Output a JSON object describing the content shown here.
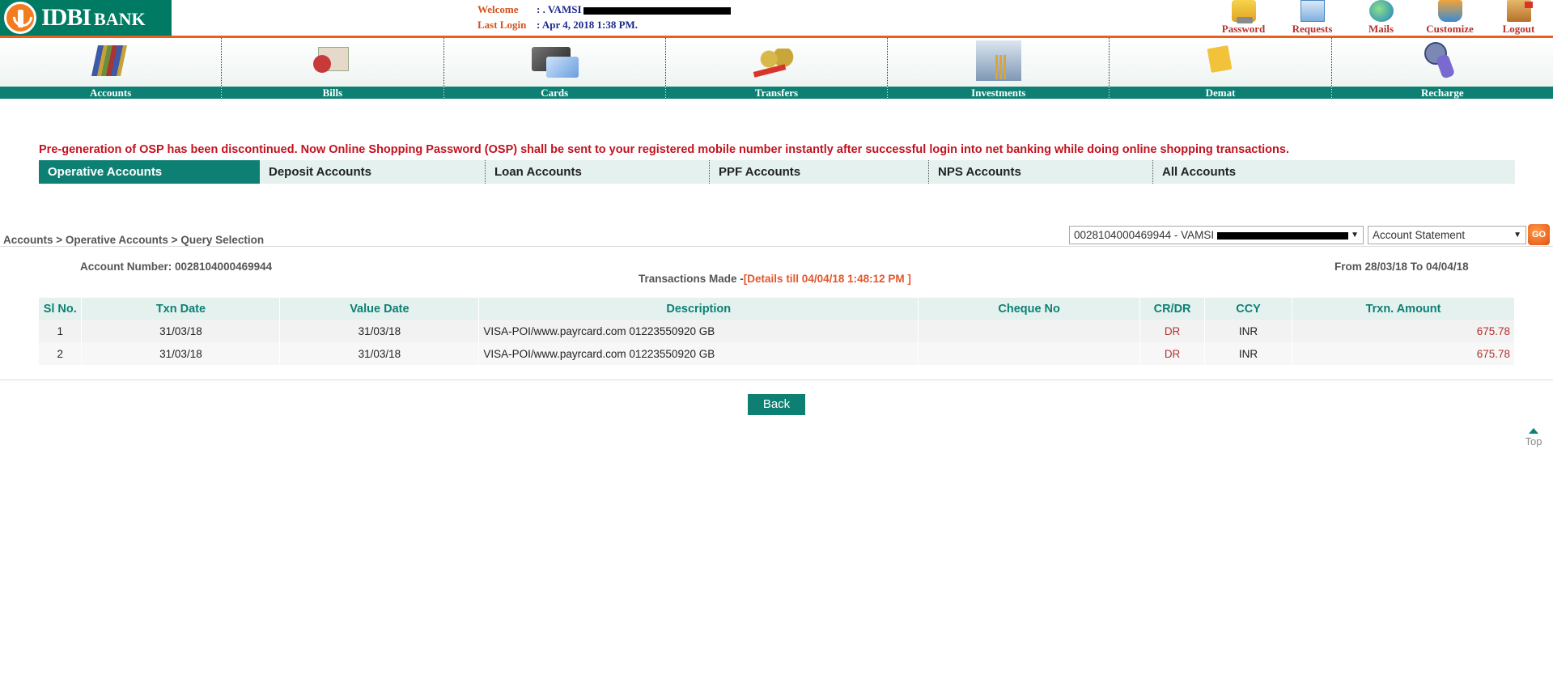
{
  "header": {
    "logo": {
      "brand": "IDBI",
      "brand_suffix": "BANK"
    },
    "welcome_label": "Welcome",
    "welcome_value": ": . VAMSI",
    "last_login_label": "Last Login",
    "last_login_value": ":  Apr 4, 2018 1:38 PM.",
    "top_links": [
      {
        "label": "Password",
        "icon": "key-pad-icon"
      },
      {
        "label": "Requests",
        "icon": "document-icon"
      },
      {
        "label": "Mails",
        "icon": "globe-mail-icon"
      },
      {
        "label": "Customize",
        "icon": "toolbox-icon"
      },
      {
        "label": "Logout",
        "icon": "door-exit-icon"
      }
    ]
  },
  "main_nav": [
    {
      "label": "Accounts",
      "icon": "books-icon"
    },
    {
      "label": "Bills",
      "icon": "bill-stamp-icon"
    },
    {
      "label": "Cards",
      "icon": "credit-card-icon"
    },
    {
      "label": "Transfers",
      "icon": "coins-transfer-icon"
    },
    {
      "label": "Investments",
      "icon": "investment-chart-icon"
    },
    {
      "label": "Demat",
      "icon": "note-pencil-icon"
    },
    {
      "label": "Recharge",
      "icon": "mobile-recharge-icon"
    }
  ],
  "notice": "Pre-generation of OSP has been discontinued. Now Online Shopping Password (OSP) shall be sent to your registered mobile number instantly after successful login into net banking while doing online shopping transactions.",
  "account_tabs": [
    {
      "label": "Operative Accounts",
      "active": true
    },
    {
      "label": "Deposit Accounts",
      "active": false
    },
    {
      "label": "Loan Accounts",
      "active": false
    },
    {
      "label": "PPF Accounts",
      "active": false
    },
    {
      "label": "NPS Accounts",
      "active": false
    },
    {
      "label": "All Accounts",
      "active": false
    }
  ],
  "breadcrumb": "Accounts > Operative Accounts > Query Selection",
  "account_select": {
    "value": "0028104000469944 - VAMSI"
  },
  "query_select": {
    "value": "Account Statement"
  },
  "go_label": "GO",
  "account_number_line": "Account Number: 0028104000469944",
  "transactions_made_label": "Transactions Made -",
  "transactions_details": "[Details till 04/04/18 1:48:12 PM ]",
  "period": "From 28/03/18 To 04/04/18",
  "table": {
    "headers": [
      "Sl No.",
      "Txn Date",
      "Value Date",
      "Description",
      "Cheque No",
      "CR/DR",
      "CCY",
      "Trxn. Amount"
    ],
    "rows": [
      [
        "1",
        "31/03/18",
        "31/03/18",
        "VISA-POI/www.payrcard.com 01223550920 GB",
        "",
        "DR",
        "INR",
        "675.78"
      ],
      [
        "2",
        "31/03/18",
        "31/03/18",
        "VISA-POI/www.payrcard.com 01223550920 GB",
        "",
        "DR",
        "INR",
        "675.78"
      ]
    ]
  },
  "back_label": "Back",
  "top_label": "Top",
  "colors": {
    "brand_green": "#007a63",
    "nav_teal": "#0e8073",
    "accent_orange": "#e8601c",
    "notice_red": "#c1121f",
    "debit_red": "#b5322c"
  }
}
